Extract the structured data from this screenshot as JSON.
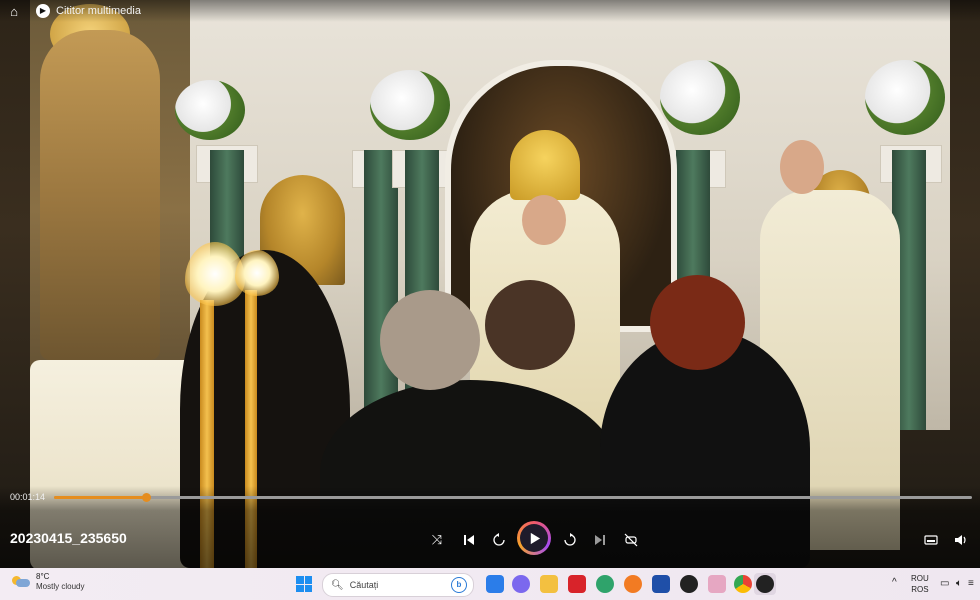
{
  "window": {
    "title": "Cititor multimedia"
  },
  "player": {
    "elapsed": "00:01:14",
    "progress_fraction": 0.1,
    "file_name": "20230415_235650",
    "accent_color": "#e58d1f"
  },
  "controls": {
    "shuffle_icon": "shuffle-icon",
    "previous_icon": "previous-icon",
    "rewind_icon": "rewind-10-icon",
    "play_icon": "play-icon",
    "forward_icon": "forward-30-icon",
    "next_icon": "next-icon",
    "repeat_icon": "repeat-off-icon",
    "miniplayer_icon": "miniplayer-icon",
    "volume_icon": "volume-icon"
  },
  "taskbar": {
    "weather": {
      "temperature": "8°C",
      "condition": "Mostly cloudy"
    },
    "search_placeholder": "Căutați",
    "language": {
      "line1": "ROU",
      "line2": "ROS"
    }
  }
}
